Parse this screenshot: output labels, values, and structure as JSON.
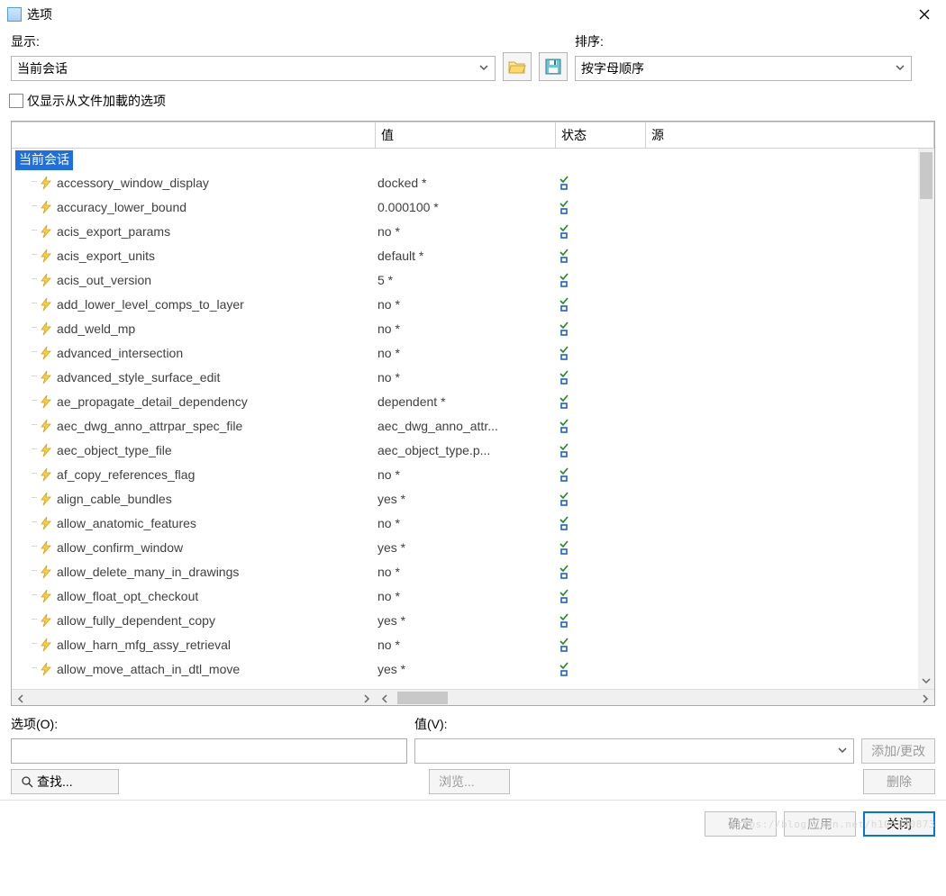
{
  "title": "选项",
  "top": {
    "display_label": "显示:",
    "display_value": "当前会话",
    "sort_label": "排序:",
    "sort_value": "按字母顺序",
    "checkbox_label": "仅显示从文件加載的选项"
  },
  "columns": {
    "name": "",
    "value": "值",
    "status": "状态",
    "source": "源"
  },
  "group_label": "当前会话",
  "options": [
    {
      "name": "accessory_window_display",
      "value": "docked *"
    },
    {
      "name": "accuracy_lower_bound",
      "value": "0.000100 *"
    },
    {
      "name": "acis_export_params",
      "value": "no *"
    },
    {
      "name": "acis_export_units",
      "value": "default *"
    },
    {
      "name": "acis_out_version",
      "value": "5 *"
    },
    {
      "name": "add_lower_level_comps_to_layer",
      "value": "no *"
    },
    {
      "name": "add_weld_mp",
      "value": "no *"
    },
    {
      "name": "advanced_intersection",
      "value": "no *"
    },
    {
      "name": "advanced_style_surface_edit",
      "value": "no *"
    },
    {
      "name": "ae_propagate_detail_dependency",
      "value": "dependent *"
    },
    {
      "name": "aec_dwg_anno_attrpar_spec_file",
      "value": "aec_dwg_anno_attr..."
    },
    {
      "name": "aec_object_type_file",
      "value": "aec_object_type.p..."
    },
    {
      "name": "af_copy_references_flag",
      "value": "no *"
    },
    {
      "name": "align_cable_bundles",
      "value": "yes *"
    },
    {
      "name": "allow_anatomic_features",
      "value": "no *"
    },
    {
      "name": "allow_confirm_window",
      "value": "yes *"
    },
    {
      "name": "allow_delete_many_in_drawings",
      "value": "no *"
    },
    {
      "name": "allow_float_opt_checkout",
      "value": "no *"
    },
    {
      "name": "allow_fully_dependent_copy",
      "value": "yes *"
    },
    {
      "name": "allow_harn_mfg_assy_retrieval",
      "value": "no *"
    },
    {
      "name": "allow_move_attach_in_dtl_move",
      "value": "yes *"
    }
  ],
  "bottom": {
    "option_label": "选项(O):",
    "value_label": "值(V):",
    "add_change": "添加/更改",
    "find": "查找...",
    "browse": "浏览...",
    "delete": "删除"
  },
  "footer": {
    "ok": "确定",
    "apply": "应用",
    "close": "关闭"
  }
}
